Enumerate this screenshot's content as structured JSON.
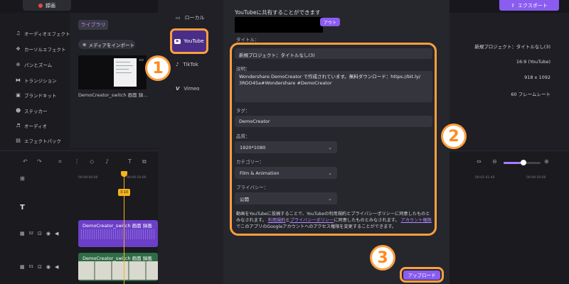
{
  "topbar": {
    "record_label": "録画",
    "export_label": "エクスポート"
  },
  "leftnav": {
    "items": [
      {
        "label": "オーディオエフェクト",
        "icon": "audio-effect-icon"
      },
      {
        "label": "カーソルエフェクト",
        "icon": "cursor-effect-icon"
      },
      {
        "label": "パンとズーム",
        "icon": "pan-zoom-icon"
      },
      {
        "label": "トランジション",
        "icon": "transition-icon"
      },
      {
        "label": "ブランドキット",
        "icon": "brand-kit-icon"
      },
      {
        "label": "ステッカー",
        "icon": "sticker-icon"
      },
      {
        "label": "オーディオ",
        "icon": "audio-icon"
      },
      {
        "label": "エフェクトパック",
        "icon": "effect-pack-icon"
      }
    ]
  },
  "library": {
    "tag": "ライブラリ",
    "import_label": "メディアをインポート",
    "clip_caption": "DemoCreator_switch 画面 録..."
  },
  "rightpanel": {
    "project": "新規プロジェクト：タイトルなし(3)",
    "ratio": "16:9 (YouTube)",
    "resolution": "918 x 1092",
    "framerate": "60 フレームレート"
  },
  "timeline": {
    "ruler": [
      "00:00:00:00",
      "00:00:10:00",
      "00:01:41:40",
      "00:00:50:00"
    ],
    "playhead_tag": "3:10",
    "audio_clip": "DemoCreator_switch 画面 録画",
    "video_clip": "DemoCreator_switch 画面 録画",
    "track_02": "02",
    "track_01": "01"
  },
  "modal": {
    "platforms": [
      {
        "label": "ローカル",
        "icon": "local-icon"
      },
      {
        "label": "YouTube",
        "icon": "youtube-icon"
      },
      {
        "label": "TikTok",
        "icon": "tiktok-icon"
      },
      {
        "label": "Vimeo",
        "icon": "vimeo-icon"
      }
    ],
    "share_text": "YouTubeに共有することができます",
    "logout_label": "アウト",
    "title_label": "タイトル：",
    "title_value": "新規プロジェクト：タイトルなし(3)",
    "desc_label": "説明：",
    "desc_value_1": "Wondershare DemoCreator で作成されています。無料ダウンロード：https://bit.ly/",
    "desc_value_2": "3RDO45a#Wondershare #DemoCreator",
    "tag_label": "タグ：",
    "tag_value": "DemoCreator",
    "quality_label": "品質：",
    "quality_value": "1920*1080",
    "category_label": "カテゴリー：",
    "category_value": "Film & Animation",
    "privacy_label": "プライバシー：",
    "privacy_value": "公開",
    "terms_1": "動画をYouTubeに投稿することで、YouTubeの利用規約とプライバシーポリシーに同意したものとみなされます。",
    "terms_link_1": "利用規約",
    "terms_and": "と",
    "terms_link_2": "プライバシーポリシー",
    "terms_2": "に同意したものとみなされます。",
    "terms_link_3": "アカウント権限",
    "terms_3": "でこのアプリのGoogleアカウントへのアクセス権限を変更することができます。",
    "upload_label": "アップロード"
  },
  "callouts": [
    "1",
    "2",
    "3"
  ],
  "colors": {
    "accent": "#8a5cf0",
    "callout": "#ff9f3f",
    "playhead": "#f4b41a"
  }
}
